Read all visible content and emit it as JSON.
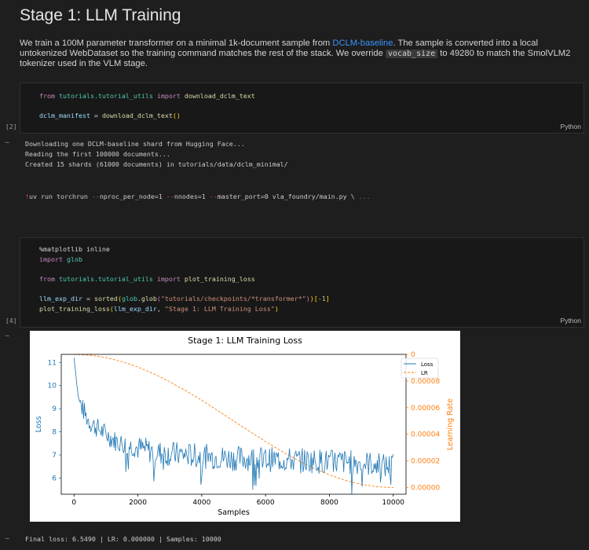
{
  "markdown": {
    "title": "Stage 1: LLM Training",
    "para_part1": "We train a 100M parameter transformer on a minimal 1k-document sample from ",
    "link_text": "DCLM-baseline",
    "para_part2": ". The sample is converted into a local untokenized WebDataset so the training command matches the rest of the stack. We override ",
    "code_text": "vocab_size",
    "para_part3": " to 49280 to match the SmolVLM2 tokenizer used in the VLM stage."
  },
  "cell1": {
    "exec_count": "[2]",
    "language": "Python",
    "line1": {
      "kw": "from",
      "mod": "tutorials.tutorial_utils",
      "kw2": "import",
      "fn": "download_dclm_text"
    },
    "line2": {
      "var": "dclm_manifest",
      "eq": " = ",
      "fn": "download_dclm_text",
      "parens": "()"
    }
  },
  "output1": {
    "ellipsis": "...",
    "lines": [
      "Downloading one DCLM-baseline shard from Hugging Face...",
      "Reading the first 100000 documents...",
      "Created 15 shards (61000 documents) in tutorials/data/dclm_minimal/"
    ],
    "command": {
      "bang": "!",
      "p1": "uv run torchrun ",
      "d1": "--",
      "p2": "nproc_per_node=1 ",
      "d2": "--",
      "p3": "nnodes=1 ",
      "d3": "--",
      "p4": "master_port=0 vla_foundry/main.py \\ ",
      "more": "..."
    }
  },
  "cell2": {
    "exec_count": "[4]",
    "language": "Python",
    "l1": "%matplotlib inline",
    "l2_kw": "import",
    "l2_mod": "glob",
    "l3_kw": "from",
    "l3_mod": "tutorials.tutorial_utils",
    "l3_kw2": "import",
    "l3_fn": "plot_training_loss",
    "l4_var": "llm_exp_dir",
    "l4_eq": " = ",
    "l4_fn": "sorted",
    "l4_mod": "glob",
    "l4_dot": ".",
    "l4_fn2": "glob",
    "l4_str": "\"tutorials/checkpoints/*transformer*\"",
    "l4_idx": "-1",
    "l5_fn": "plot_training_loss",
    "l5_var": "llm_exp_dir",
    "l5_sep": ", ",
    "l5_str": "\"Stage 1: LLM Training Loss\""
  },
  "output2": {
    "ellipsis": "...",
    "final_line": "Final loss: 6.5490 | LR: 0.000000 | Samples: 10000"
  },
  "colors": {
    "loss": "#1f77b4",
    "lr": "#ff7f0e"
  },
  "chart_data": {
    "type": "line",
    "title": "Stage 1: LLM Training Loss",
    "xlabel": "Samples",
    "ylabel_left": "Loss",
    "ylabel_right": "Learning Rate",
    "xlim": [
      -400,
      10400
    ],
    "ylim_left": [
      5.3,
      11.35
    ],
    "ylim_right": [
      -5e-06,
      0.0001
    ],
    "xticks": [
      0,
      2000,
      4000,
      6000,
      8000,
      10000
    ],
    "yticks_left": [
      6,
      7,
      8,
      9,
      10,
      11
    ],
    "yticks_right": [
      "0.00000",
      "0.00002",
      "0.00004",
      "0.00006",
      "0.00008",
      "0"
    ],
    "yticks_right_values": [
      0,
      2e-05,
      4e-05,
      6e-05,
      8e-05,
      0.0001
    ],
    "legend": [
      "Loss",
      "LR"
    ],
    "legend_position": "top-right",
    "series": [
      {
        "name": "Loss",
        "axis": "left",
        "x": [
          0,
          50,
          100,
          150,
          200,
          300,
          400,
          500,
          700,
          900,
          1100,
          1300,
          1500,
          1700,
          2000,
          2300,
          2600,
          3000,
          3500,
          4000,
          4500,
          5000,
          5500,
          6000,
          6500,
          7000,
          7500,
          8000,
          8500,
          9000,
          9500,
          9800,
          10000
        ],
        "y": [
          11.2,
          10.6,
          9.9,
          9.4,
          9.2,
          8.9,
          8.6,
          8.4,
          8.2,
          8.0,
          7.8,
          7.6,
          7.5,
          7.4,
          7.3,
          7.2,
          7.1,
          7.05,
          7.0,
          6.95,
          6.9,
          6.85,
          6.85,
          6.8,
          6.8,
          6.75,
          6.75,
          6.7,
          6.7,
          6.65,
          6.6,
          6.5,
          6.55
        ]
      },
      {
        "name": "LR",
        "axis": "right",
        "x": [
          0,
          500,
          1000,
          1500,
          2000,
          2500,
          3000,
          3500,
          4000,
          4500,
          5000,
          5500,
          6000,
          6500,
          7000,
          7500,
          8000,
          8500,
          9000,
          9500,
          10000
        ],
        "y": [
          0.0001,
          9.94e-05,
          9.76e-05,
          9.46e-05,
          9.05e-05,
          8.54e-05,
          7.94e-05,
          7.27e-05,
          6.55e-05,
          5.78e-05,
          5e-05,
          4.22e-05,
          3.45e-05,
          2.73e-05,
          2.06e-05,
          1.46e-05,
          9.5e-06,
          5.4e-06,
          2.4e-06,
          6e-07,
          0.0
        ]
      }
    ]
  }
}
